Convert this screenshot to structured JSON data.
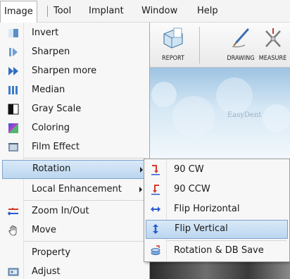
{
  "menubar": {
    "items": [
      {
        "label": "Image",
        "active": true
      },
      {
        "label": "Tool"
      },
      {
        "label": "Implant"
      },
      {
        "label": "Window"
      },
      {
        "label": "Help"
      }
    ]
  },
  "toolbar": {
    "buttons": [
      {
        "label": "REPORT",
        "icon": "report-icon"
      },
      {
        "label": "DRAWING",
        "icon": "drawing-icon"
      },
      {
        "label": "MEASURE",
        "icon": "measure-icon"
      }
    ]
  },
  "banner": {
    "logo": "EasyDent"
  },
  "image_menu": {
    "items": [
      {
        "label": "Invert",
        "icon": "invert-icon"
      },
      {
        "label": "Sharpen",
        "icon": "sharpen-icon"
      },
      {
        "label": "Sharpen more",
        "icon": "sharpen-more-icon"
      },
      {
        "label": "Median",
        "icon": "median-icon"
      },
      {
        "label": "Gray Scale",
        "icon": "gray-scale-icon"
      },
      {
        "label": "Coloring",
        "icon": "coloring-icon"
      },
      {
        "label": "Film Effect",
        "icon": "film-effect-icon"
      },
      {
        "label": "Rotation",
        "icon": "",
        "submenu": true,
        "selected": true
      },
      {
        "label": "Local Enhancement",
        "icon": "",
        "submenu": true
      },
      {
        "label": "Zoom In/Out",
        "icon": "zoom-icon"
      },
      {
        "label": "Move",
        "icon": "hand-icon"
      },
      {
        "label": "Property",
        "icon": ""
      },
      {
        "label": "Adjust",
        "icon": "adjust-icon"
      }
    ]
  },
  "rotation_submenu": {
    "items": [
      {
        "label": "90 CW",
        "icon": "rotate-cw-icon"
      },
      {
        "label": "90 CCW",
        "icon": "rotate-ccw-icon"
      },
      {
        "label": "Flip Horizontal",
        "icon": "flip-horizontal-icon"
      },
      {
        "label": "Flip Vertical",
        "icon": "flip-vertical-icon",
        "selected": true
      },
      {
        "label": "Rotation & DB Save",
        "icon": "rotation-db-save-icon"
      }
    ]
  },
  "colors": {
    "highlight_top": "#d9e9f8",
    "highlight_bottom": "#bcd6ef",
    "highlight_border": "#7da2ce",
    "menu_bg": "#f7f7f7"
  }
}
